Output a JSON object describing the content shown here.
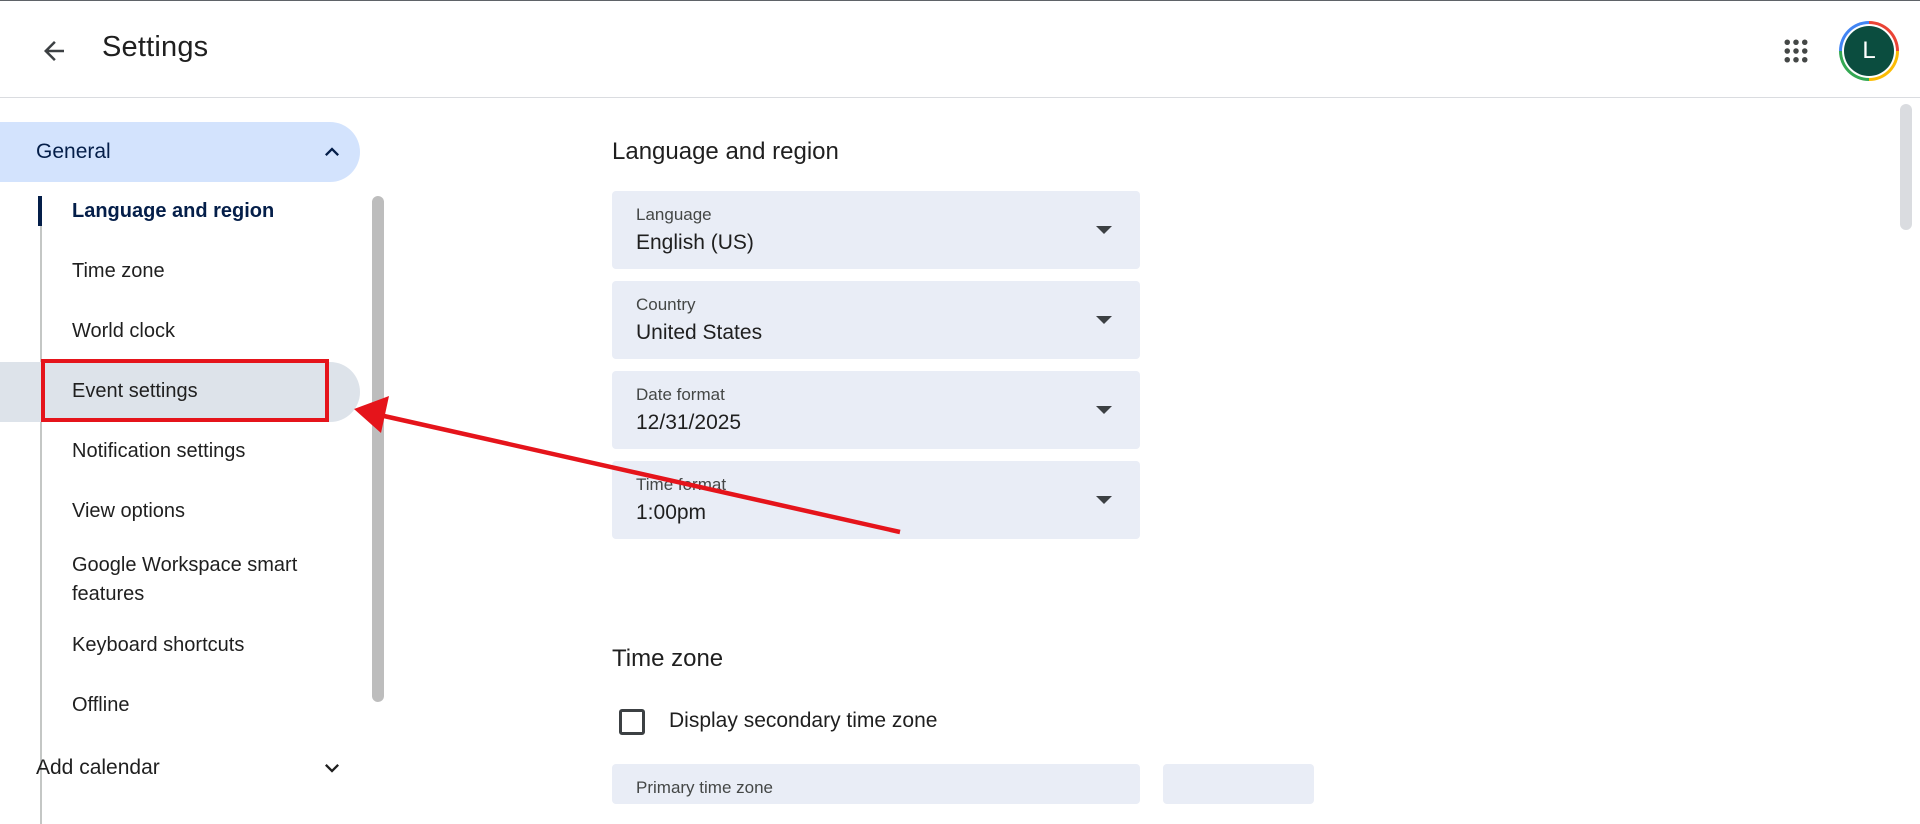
{
  "header": {
    "title": "Settings",
    "back_icon": "arrow-back-icon",
    "apps_icon": "apps-grid-icon",
    "avatar_letter": "L",
    "avatar_color": "#0b4d3f"
  },
  "sidebar": {
    "general_label": "General",
    "items": [
      {
        "label": "Language and region",
        "active": true
      },
      {
        "label": "Time zone",
        "active": false
      },
      {
        "label": "World clock",
        "active": false
      },
      {
        "label": "Event settings",
        "active": false,
        "highlighted": true
      },
      {
        "label": "Notification settings",
        "active": false
      },
      {
        "label": "View options",
        "active": false
      },
      {
        "label": "Google Workspace smart features",
        "active": false
      },
      {
        "label": "Keyboard shortcuts",
        "active": false
      },
      {
        "label": "Offline",
        "active": false
      }
    ],
    "add_calendar_label": "Add calendar"
  },
  "main": {
    "language_region": {
      "title": "Language and region",
      "fields": [
        {
          "label": "Language",
          "value": "English (US)"
        },
        {
          "label": "Country",
          "value": "United States"
        },
        {
          "label": "Date format",
          "value": "12/31/2025"
        },
        {
          "label": "Time format",
          "value": "1:00pm"
        }
      ]
    },
    "time_zone": {
      "title": "Time zone",
      "checkbox_label": "Display secondary time zone",
      "checkbox_checked": false,
      "primary_label": "Primary time zone"
    }
  },
  "colors": {
    "accent_nav": "#d3e3fd",
    "field_bg": "#e9edf6",
    "annotation_red": "#e5141b"
  }
}
